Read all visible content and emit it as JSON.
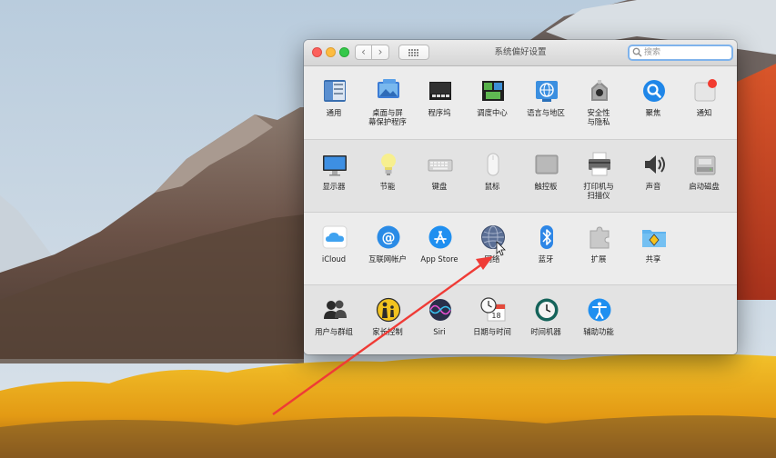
{
  "window": {
    "title": "系统偏好设置",
    "search_placeholder": "搜索"
  },
  "nav": {
    "back": "‹",
    "forward": "›"
  },
  "sections": [
    {
      "items": [
        {
          "label": "通用",
          "icon": "general-icon"
        },
        {
          "label": "桌面与屏幕保护程序",
          "icon": "desktop-screensaver-icon"
        },
        {
          "label": "程序坞",
          "icon": "dock-icon"
        },
        {
          "label": "调度中心",
          "icon": "mission-control-icon"
        },
        {
          "label": "语言与地区",
          "icon": "language-region-icon"
        },
        {
          "label": "安全性与隐私",
          "icon": "security-privacy-icon"
        },
        {
          "label": "聚焦",
          "icon": "spotlight-icon"
        },
        {
          "label": "通知",
          "icon": "notifications-icon"
        }
      ]
    },
    {
      "items": [
        {
          "label": "显示器",
          "icon": "displays-icon"
        },
        {
          "label": "节能",
          "icon": "energy-saver-icon"
        },
        {
          "label": "键盘",
          "icon": "keyboard-icon"
        },
        {
          "label": "鼠标",
          "icon": "mouse-icon"
        },
        {
          "label": "触控板",
          "icon": "trackpad-icon"
        },
        {
          "label": "打印机与扫描仪",
          "icon": "printers-scanners-icon"
        },
        {
          "label": "声音",
          "icon": "sound-icon"
        },
        {
          "label": "启动磁盘",
          "icon": "startup-disk-icon"
        }
      ]
    },
    {
      "items": [
        {
          "label": "iCloud",
          "icon": "icloud-icon"
        },
        {
          "label": "互联网帐户",
          "icon": "internet-accounts-icon"
        },
        {
          "label": "App Store",
          "icon": "app-store-icon"
        },
        {
          "label": "网络",
          "icon": "network-icon"
        },
        {
          "label": "蓝牙",
          "icon": "bluetooth-icon"
        },
        {
          "label": "扩展",
          "icon": "extensions-icon"
        },
        {
          "label": "共享",
          "icon": "sharing-icon"
        }
      ]
    },
    {
      "items": [
        {
          "label": "用户与群组",
          "icon": "users-groups-icon"
        },
        {
          "label": "家长控制",
          "icon": "parental-controls-icon"
        },
        {
          "label": "Siri",
          "icon": "siri-icon"
        },
        {
          "label": "日期与时间",
          "icon": "date-time-icon"
        },
        {
          "label": "时间机器",
          "icon": "time-machine-icon"
        },
        {
          "label": "辅助功能",
          "icon": "accessibility-icon"
        }
      ]
    }
  ],
  "colors": {
    "search_focus": "#7fb3ec",
    "annotation_arrow": "#ef3b36",
    "close": "#fc605c",
    "minimize": "#fdbc40",
    "zoom": "#34c84a"
  }
}
